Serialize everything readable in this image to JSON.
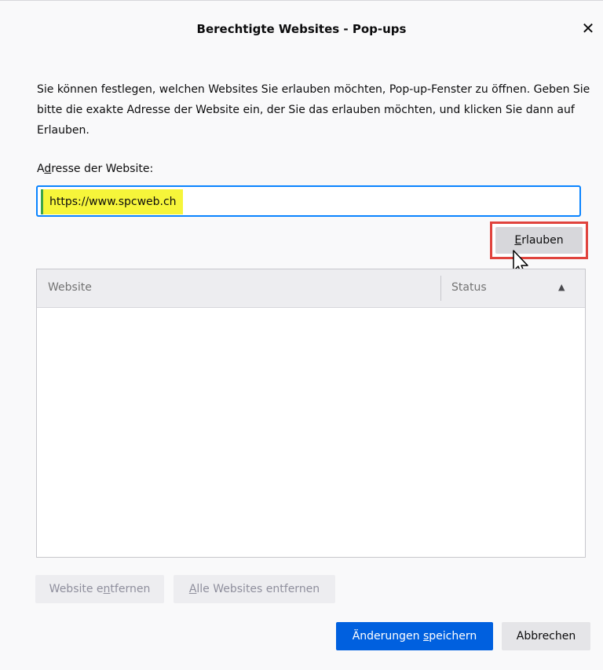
{
  "dialog": {
    "title": "Berechtigte Websites - Pop-ups",
    "close_glyph": "✕"
  },
  "description": "Sie können festlegen, welchen Websites Sie erlauben möchten, Pop-up-Fenster zu öffnen. Geben Sie bitte die exakte Adresse der Website ein, der Sie das erlauben möchten, und klicken Sie dann auf Erlauben.",
  "address": {
    "label_pre": "A",
    "label_key": "d",
    "label_post": "resse der Website:",
    "value": "https://www.spcweb.ch"
  },
  "allow_button": {
    "key": "E",
    "rest": "rlauben"
  },
  "table": {
    "columns": [
      "Website",
      "Status"
    ],
    "sort_icon": "▲",
    "rows": []
  },
  "buttons": {
    "remove_pre": "Website e",
    "remove_key": "n",
    "remove_post": "tfernen",
    "remove_all_key": "A",
    "remove_all_post": "lle Websites entfernen",
    "save_pre": "Änderungen ",
    "save_key": "s",
    "save_post": "peichern",
    "cancel": "Abbrechen"
  },
  "colors": {
    "accent": "#0060df",
    "focus_ring": "#0a84ff",
    "highlight": "#f6f53a",
    "callout": "#e0433d"
  }
}
